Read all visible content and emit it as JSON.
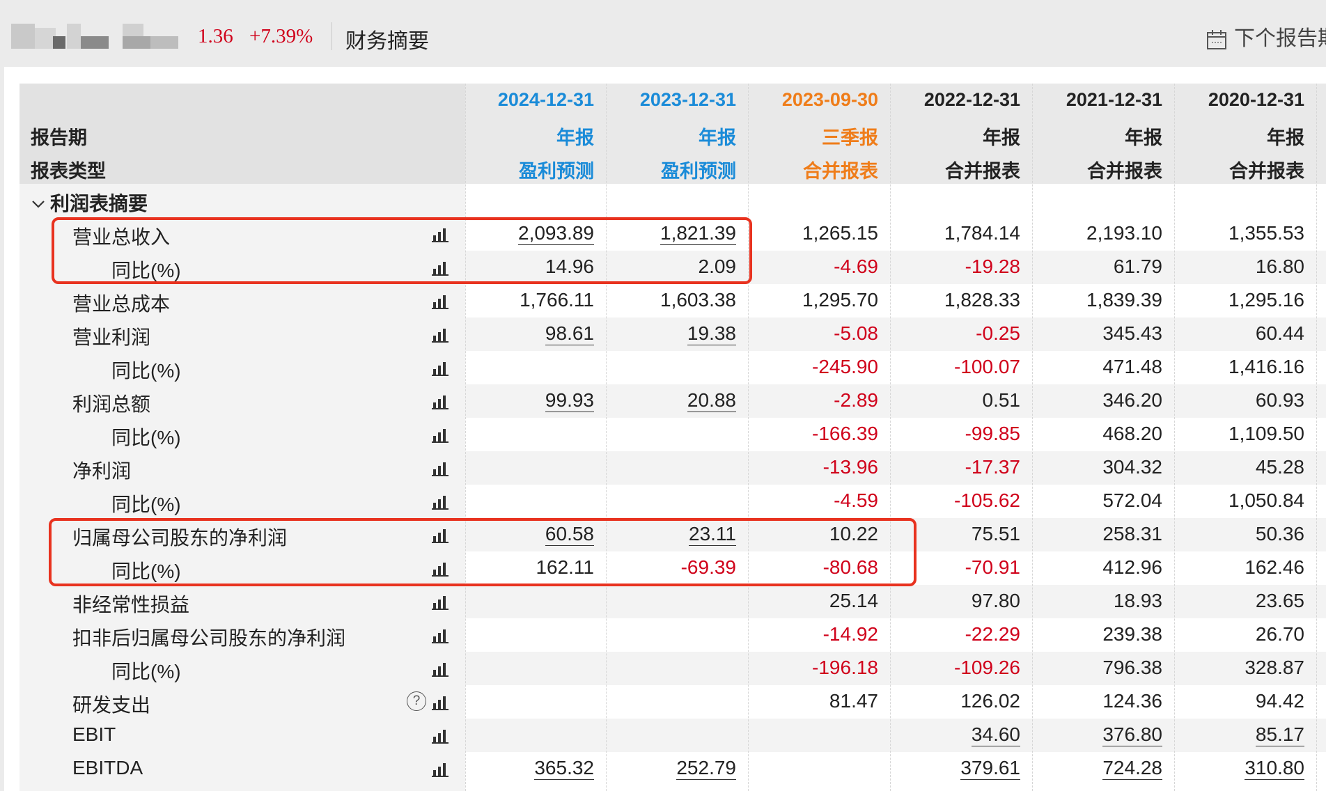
{
  "header": {
    "price_tail": "1.36",
    "change_pct": "+7.39%",
    "page_title": "财务摘要",
    "next_report": "下个报告期"
  },
  "columns": [
    {
      "date": "2024-12-31",
      "period": "年报",
      "type": "盈利预测",
      "color": "#1a8bd8"
    },
    {
      "date": "2023-12-31",
      "period": "年报",
      "type": "盈利预测",
      "color": "#1a8bd8"
    },
    {
      "date": "2023-09-30",
      "period": "三季报",
      "type": "合并报表",
      "color": "#ef7d1a"
    },
    {
      "date": "2022-12-31",
      "period": "年报",
      "type": "合并报表",
      "color": "#222222"
    },
    {
      "date": "2021-12-31",
      "period": "年报",
      "type": "合并报表",
      "color": "#222222"
    },
    {
      "date": "2020-12-31",
      "period": "年报",
      "type": "合并报表",
      "color": "#222222"
    }
  ],
  "table_header": {
    "period_label": "报告期",
    "type_label": "报表类型"
  },
  "section": {
    "title": "利润表摘要",
    "rows": [
      {
        "label": "营业总收入",
        "sub": false,
        "values": [
          "2,093.89",
          "1,821.39",
          "1,265.15",
          "1,784.14",
          "2,193.10",
          "1,355.53"
        ]
      },
      {
        "label": "同比(%)",
        "sub": true,
        "values": [
          "14.96",
          "2.09",
          "-4.69",
          "-19.28",
          "61.79",
          "16.80"
        ]
      },
      {
        "label": "营业总成本",
        "sub": false,
        "values": [
          "1,766.11",
          "1,603.38",
          "1,295.70",
          "1,828.33",
          "1,839.39",
          "1,295.16"
        ]
      },
      {
        "label": "营业利润",
        "sub": false,
        "values": [
          "98.61",
          "19.38",
          "-5.08",
          "-0.25",
          "345.43",
          "60.44"
        ]
      },
      {
        "label": "同比(%)",
        "sub": true,
        "values": [
          "",
          "",
          "-245.90",
          "-100.07",
          "471.48",
          "1,416.16"
        ]
      },
      {
        "label": "利润总额",
        "sub": false,
        "values": [
          "99.93",
          "20.88",
          "-2.89",
          "0.51",
          "346.20",
          "60.93"
        ]
      },
      {
        "label": "同比(%)",
        "sub": true,
        "values": [
          "",
          "",
          "-166.39",
          "-99.85",
          "468.20",
          "1,109.50"
        ]
      },
      {
        "label": "净利润",
        "sub": false,
        "values": [
          "",
          "",
          "-13.96",
          "-17.37",
          "304.32",
          "45.28"
        ]
      },
      {
        "label": "同比(%)",
        "sub": true,
        "values": [
          "",
          "",
          "-4.59",
          "-105.62",
          "572.04",
          "1,050.84"
        ]
      },
      {
        "label": "归属母公司股东的净利润",
        "sub": false,
        "values": [
          "60.58",
          "23.11",
          "10.22",
          "75.51",
          "258.31",
          "50.36"
        ]
      },
      {
        "label": "同比(%)",
        "sub": true,
        "values": [
          "162.11",
          "-69.39",
          "-80.68",
          "-70.91",
          "412.96",
          "162.46"
        ]
      },
      {
        "label": "非经常性损益",
        "sub": false,
        "values": [
          "",
          "",
          "25.14",
          "97.80",
          "18.93",
          "23.65"
        ]
      },
      {
        "label": "扣非后归属母公司股东的净利润",
        "sub": false,
        "values": [
          "",
          "",
          "-14.92",
          "-22.29",
          "239.38",
          "26.70"
        ]
      },
      {
        "label": "同比(%)",
        "sub": true,
        "values": [
          "",
          "",
          "-196.18",
          "-109.26",
          "796.38",
          "328.87"
        ]
      },
      {
        "label": "研发支出",
        "sub": false,
        "help": true,
        "values": [
          "",
          "",
          "81.47",
          "126.02",
          "124.36",
          "94.42"
        ]
      },
      {
        "label": "EBIT",
        "sub": false,
        "values": [
          "",
          "",
          "",
          "34.60",
          "376.80",
          "85.17"
        ]
      },
      {
        "label": "EBITDA",
        "sub": false,
        "values": [
          "365.32",
          "252.79",
          "",
          "379.61",
          "724.28",
          "310.80"
        ]
      }
    ]
  },
  "underlined_cells": [
    [
      0,
      0
    ],
    [
      0,
      1
    ],
    [
      3,
      0
    ],
    [
      3,
      1
    ],
    [
      5,
      0
    ],
    [
      5,
      1
    ],
    [
      9,
      0
    ],
    [
      9,
      1
    ],
    [
      15,
      3
    ],
    [
      15,
      4
    ],
    [
      15,
      5
    ],
    [
      16,
      0
    ],
    [
      16,
      1
    ],
    [
      16,
      3
    ],
    [
      16,
      4
    ],
    [
      16,
      5
    ]
  ],
  "icons": {
    "row_chart": "bar-chart-icon",
    "help": "question-icon",
    "calendar": "calendar-icon",
    "collapse": "chevron-down-icon"
  },
  "colors": {
    "negative": "#d0021b",
    "highlight_box": "#e8321f",
    "forecast": "#1a8bd8",
    "quarter": "#ef7d1a"
  }
}
